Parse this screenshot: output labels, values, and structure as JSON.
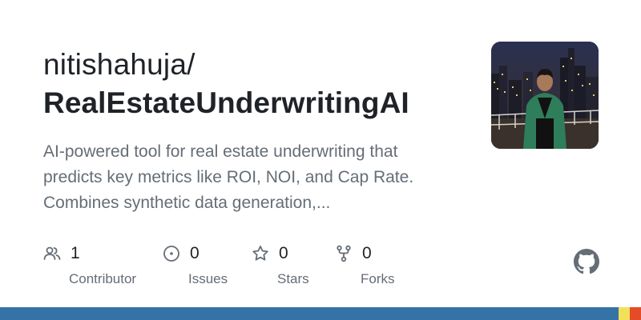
{
  "repo": {
    "owner": "nitishahuja/",
    "name": "RealEstateUnderwritingAI",
    "description_lines": [
      "AI-powered tool for real estate underwriting that",
      "predicts key metrics like ROI, NOI, and Cap Rate.",
      "Combines synthetic data generation,..."
    ]
  },
  "stats": [
    {
      "icon": "people-icon",
      "count": "1",
      "label": "Contributor"
    },
    {
      "icon": "issue-icon",
      "count": "0",
      "label": "Issues"
    },
    {
      "icon": "star-icon",
      "count": "0",
      "label": "Stars"
    },
    {
      "icon": "fork-icon",
      "count": "0",
      "label": "Forks"
    }
  ],
  "logo_icon": "github-mark-icon",
  "language_bar": [
    {
      "color": "#3572A5",
      "share": 0.965
    },
    {
      "color": "#f1e05a",
      "share": 0.018
    },
    {
      "color": "#e34c26",
      "share": 0.017
    }
  ]
}
